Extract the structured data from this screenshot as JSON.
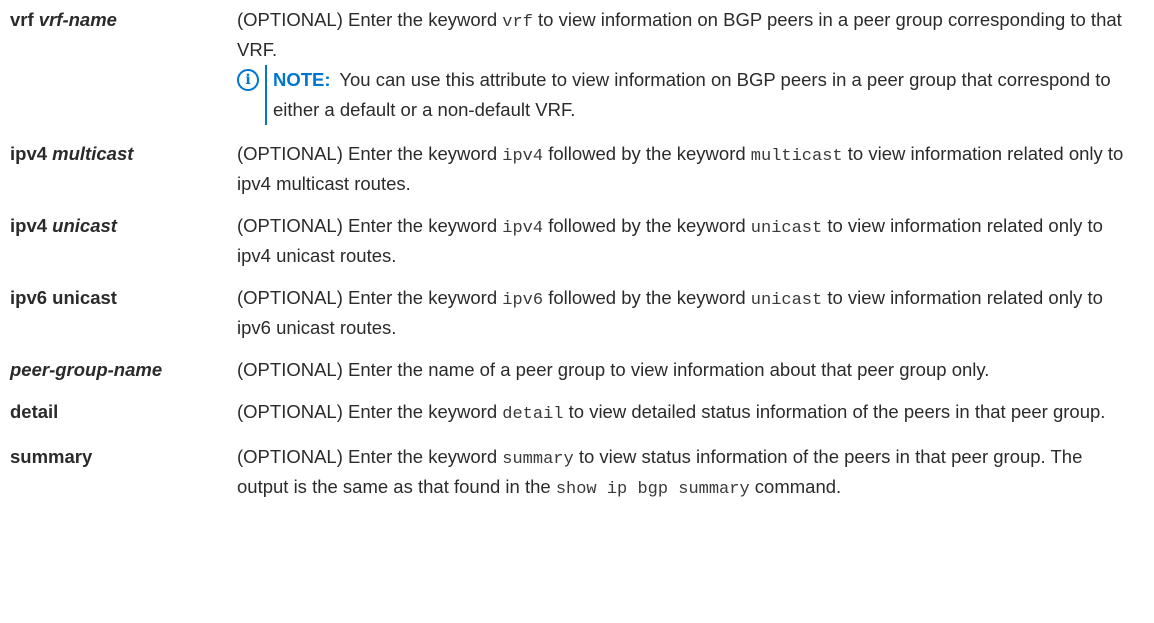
{
  "rows": [
    {
      "name_bold": "vrf",
      "name_italic": "vrf-name",
      "desc": [
        {
          "t": "(OPTIONAL) Enter the keyword "
        },
        {
          "c": "vrf"
        },
        {
          "t": " to view information on BGP peers in a peer group corresponding to that VRF."
        }
      ],
      "note": {
        "label": "NOTE:",
        "text": "You can use this attribute to view information on BGP peers in a peer group that correspond to either a default or a non-default VRF."
      }
    },
    {
      "name_bold": "ipv4",
      "name_italic": "multicast",
      "desc": [
        {
          "t": "(OPTIONAL) Enter the keyword "
        },
        {
          "c": "ipv4"
        },
        {
          "t": " followed by the keyword "
        },
        {
          "c": "multicast"
        },
        {
          "t": " to view information related only to ipv4 multicast routes."
        }
      ]
    },
    {
      "name_bold": "ipv4",
      "name_italic": "unicast",
      "desc": [
        {
          "t": "(OPTIONAL) Enter the keyword "
        },
        {
          "c": "ipv4"
        },
        {
          "t": " followed by the keyword "
        },
        {
          "c": "unicast"
        },
        {
          "t": " to view information related only to ipv4 unicast routes."
        }
      ]
    },
    {
      "name_bold": "ipv6 unicast",
      "name_italic": "",
      "desc": [
        {
          "t": "(OPTIONAL) Enter the keyword "
        },
        {
          "c": "ipv6"
        },
        {
          "t": " followed by the keyword "
        },
        {
          "c": "unicast"
        },
        {
          "t": " to view information related only to ipv6 unicast routes."
        }
      ]
    },
    {
      "name_bold": "",
      "name_italic": "peer-group-name",
      "desc": [
        {
          "t": "(OPTIONAL) Enter the name of a peer group to view information about that peer group only."
        }
      ]
    },
    {
      "name_bold": "detail",
      "name_italic": "",
      "desc": [
        {
          "t": "(OPTIONAL) Enter the keyword "
        },
        {
          "c": "detail"
        },
        {
          "t": " to view detailed status information of the peers in that peer group."
        }
      ]
    },
    {
      "name_bold": "summary",
      "name_italic": "",
      "desc": [
        {
          "t": "(OPTIONAL) Enter the keyword "
        },
        {
          "c": "summary"
        },
        {
          "t": " to view status information of the peers in that peer group. The output is the same as that found in the "
        },
        {
          "c": "show ip bgp summary"
        },
        {
          "t": " command."
        }
      ]
    }
  ],
  "note_icon_glyph": "i",
  "colors": {
    "accent": "#0076ce",
    "text": "#2b2b2b"
  }
}
